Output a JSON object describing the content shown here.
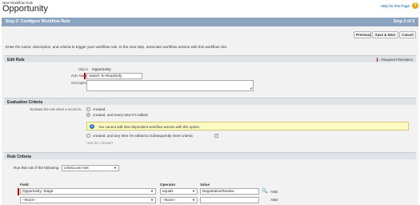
{
  "header": {
    "subtitle": "New Workflow Rule",
    "title": "Opportunity",
    "help_link": "Help for this Page",
    "help_icon": "?"
  },
  "step": {
    "title": "Step 2: Configure Workflow Rule",
    "count": "Step 2 of 3"
  },
  "buttons": {
    "previous": "Previous",
    "save_next": "Save & Next",
    "cancel": "Cancel"
  },
  "intro_text": "Enter the name, description, and criteria to trigger your workflow rule. In the next step, associate workflow actions with this workflow rule.",
  "edit_rule": {
    "section_title": "Edit Rule",
    "required_info": "= Required Information",
    "object_label": "Object",
    "object_value": "Opportunity",
    "rule_name_label": "Rule Name",
    "rule_name_value": "Switch To ReadOnly",
    "description_label": "Description",
    "description_value": ""
  },
  "evaluation": {
    "section_title": "Evaluation Criteria",
    "prompt": "Evaluate the rule when a record is:",
    "options": [
      {
        "label": "created",
        "selected": false
      },
      {
        "label": "created, and every time it's edited",
        "selected": true
      },
      {
        "label": "created, and any time it's edited to subsequently meet criteria",
        "selected": false
      }
    ],
    "info_message": "You cannot add time-dependent workflow actions with this option.",
    "info_icon": "i",
    "help_link": "How do I choose?"
  },
  "rule_criteria": {
    "section_title": "Rule Criteria",
    "run_label": "Run this rule if the following",
    "run_select": "criteria are met",
    "headers": {
      "field": "Field",
      "operator": "Operator",
      "value": "Value"
    },
    "rows": [
      {
        "field": "Opportunity: Stage",
        "operator": "equals",
        "value": "Negotiation/Review",
        "conjunction": "AND"
      },
      {
        "field": "--None--",
        "operator": "--None--",
        "value": "",
        "conjunction": "AND"
      }
    ]
  },
  "icons": {
    "caret": "▼",
    "lookup": "🔍",
    "resize": "◢"
  }
}
